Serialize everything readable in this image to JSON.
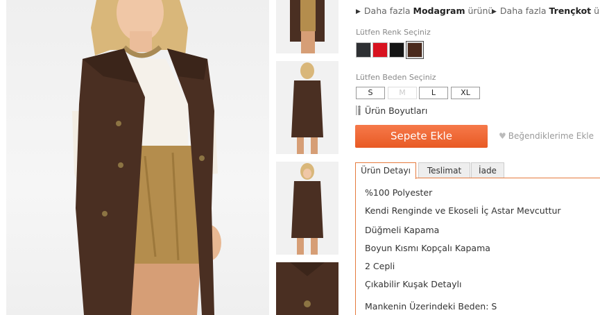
{
  "more_links": [
    {
      "prefix": "Daha fazla",
      "brand": "Modagram",
      "suffix": "ürünü"
    },
    {
      "prefix": "Daha fazla",
      "brand": "Trençkot",
      "suffix": "ürünü"
    }
  ],
  "color_section": {
    "label": "Lütfen Renk Seçiniz",
    "colors": [
      {
        "name": "dark-grey",
        "hex": "#2e3033"
      },
      {
        "name": "red",
        "hex": "#d8121f"
      },
      {
        "name": "black",
        "hex": "#151515"
      },
      {
        "name": "brown",
        "hex": "#4a2a1d",
        "selected": true
      }
    ]
  },
  "size_section": {
    "label": "Lütfen Beden Seçiniz",
    "sizes": [
      {
        "label": "S",
        "available": true
      },
      {
        "label": "M",
        "available": false
      },
      {
        "label": "L",
        "available": true
      },
      {
        "label": "XL",
        "available": true
      }
    ]
  },
  "size_guide": {
    "label": "Ürün Boyutları",
    "icon": "ruler-person-icon"
  },
  "cart_button": {
    "label": "Sepete Ekle",
    "color": "#ec6530"
  },
  "favorite": {
    "label": "Beğendiklerime Ekle",
    "icon": "heart-icon"
  },
  "tabs": [
    {
      "label": "Ürün Detayı",
      "active": true
    },
    {
      "label": "Teslimat",
      "active": false
    },
    {
      "label": "İade",
      "active": false
    }
  ],
  "details": [
    "%100 Polyester",
    "Kendi Renginde ve Ekoseli İç Astar Mevcuttur",
    "Düğmeli Kapama",
    "Boyun Kısmı Kopçalı Kapama",
    "2 Cepli",
    "Çıkabilir Kuşak Detaylı",
    "Mankenin Üzerindeki Beden: S"
  ],
  "accent_color": "#e57a3d"
}
